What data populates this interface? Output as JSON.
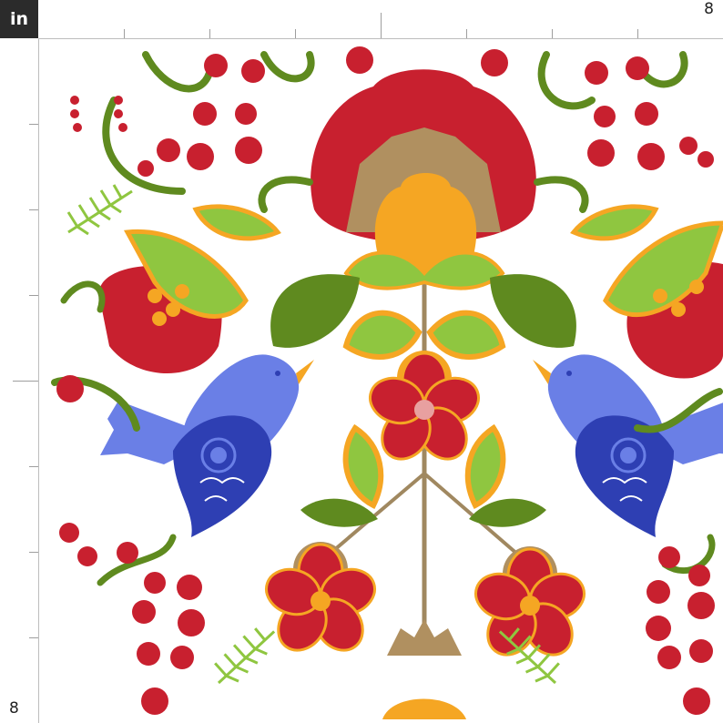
{
  "ruler": {
    "unit_label": "in",
    "top_end_value": "8",
    "left_end_value": "8"
  },
  "pattern": {
    "colors": {
      "red": "#c8202f",
      "orange": "#f5a623",
      "green_dark": "#5f8a1f",
      "green_light": "#8fc640",
      "blue_light": "#6a7fe6",
      "blue_dark": "#2e3fb3",
      "tan": "#b09060",
      "stem": "#a08860"
    }
  }
}
